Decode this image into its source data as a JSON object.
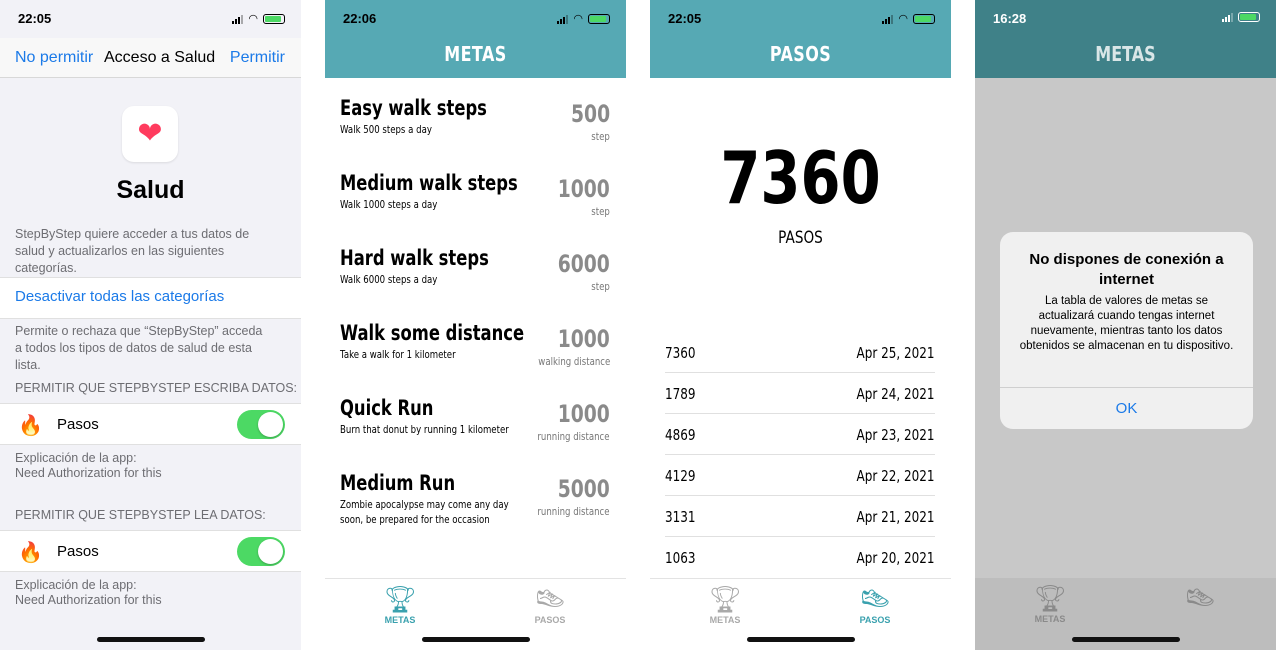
{
  "screens": {
    "health": {
      "status_time": "22:05",
      "nav": {
        "left": "No permitir",
        "center": "Acceso a Salud",
        "right": "Permitir"
      },
      "title": "Salud",
      "intro": "StepByStep quiere acceder a tus datos de salud y actualizarlos en las siguientes categorías.",
      "disable_all": "Desactivar todas las categorías",
      "explain": "Permite o rechaza que “StepByStep” acceda a todos los tipos de datos de salud de esta lista.",
      "write_header": "PERMITIR QUE STEPBYSTEP ESCRIBA DATOS:",
      "write_item": "Pasos",
      "write_note_1": "Explicación de la app:",
      "write_note_2": "Need Authorization for this",
      "read_header": "PERMITIR QUE STEPBYSTEP LEA DATOS:",
      "read_item": "Pasos",
      "read_note_1": "Explicación de la app:",
      "read_note_2": "Need Authorization for this",
      "toggle_write_on": true,
      "toggle_read_on": true
    },
    "metas": {
      "status_time": "22:06",
      "title": "METAS",
      "goals": [
        {
          "title": "Easy walk steps",
          "desc": "Walk 500 steps a day",
          "value": "500",
          "unit": "step"
        },
        {
          "title": "Medium walk steps",
          "desc": "Walk 1000 steps a day",
          "value": "1000",
          "unit": "step"
        },
        {
          "title": "Hard walk steps",
          "desc": "Walk 6000 steps a day",
          "value": "6000",
          "unit": "step"
        },
        {
          "title": "Walk some distance",
          "desc": "Take a walk for 1 kilometer",
          "value": "1000",
          "unit": "walking distance"
        },
        {
          "title": "Quick Run",
          "desc": "Burn that donut by running 1 kilometer",
          "value": "1000",
          "unit": "running distance"
        },
        {
          "title": "Medium Run",
          "desc": "Zombie apocalypse may come any day soon, be prepared for the occasion",
          "value": "5000",
          "unit": "running distance"
        }
      ],
      "tabs": {
        "metas": "METAS",
        "pasos": "PASOS"
      }
    },
    "pasos": {
      "status_time": "22:05",
      "title": "PASOS",
      "total": "7360",
      "total_label": "PASOS",
      "history": [
        {
          "steps": "7360",
          "date": "Apr 25, 2021"
        },
        {
          "steps": "1789",
          "date": "Apr 24, 2021"
        },
        {
          "steps": "4869",
          "date": "Apr 23, 2021"
        },
        {
          "steps": "4129",
          "date": "Apr 22, 2021"
        },
        {
          "steps": "3131",
          "date": "Apr 21, 2021"
        },
        {
          "steps": "1063",
          "date": "Apr 20, 2021"
        }
      ],
      "tabs": {
        "metas": "METAS",
        "pasos": "PASOS"
      }
    },
    "offline": {
      "status_time": "16:28",
      "title": "METAS",
      "alert_title": "No dispones de conexión a internet",
      "alert_message": "La tabla de valores de metas se actualizará cuando tengas internet nuevamente, mientras tanto los datos obtenidos se almacenan en tu dispositivo.",
      "alert_button": "OK",
      "tabs": {
        "metas": "METAS"
      }
    }
  },
  "colors": {
    "teal": "#56a9b4",
    "ios_blue": "#1b7ae8",
    "ios_green": "#4cd964"
  }
}
